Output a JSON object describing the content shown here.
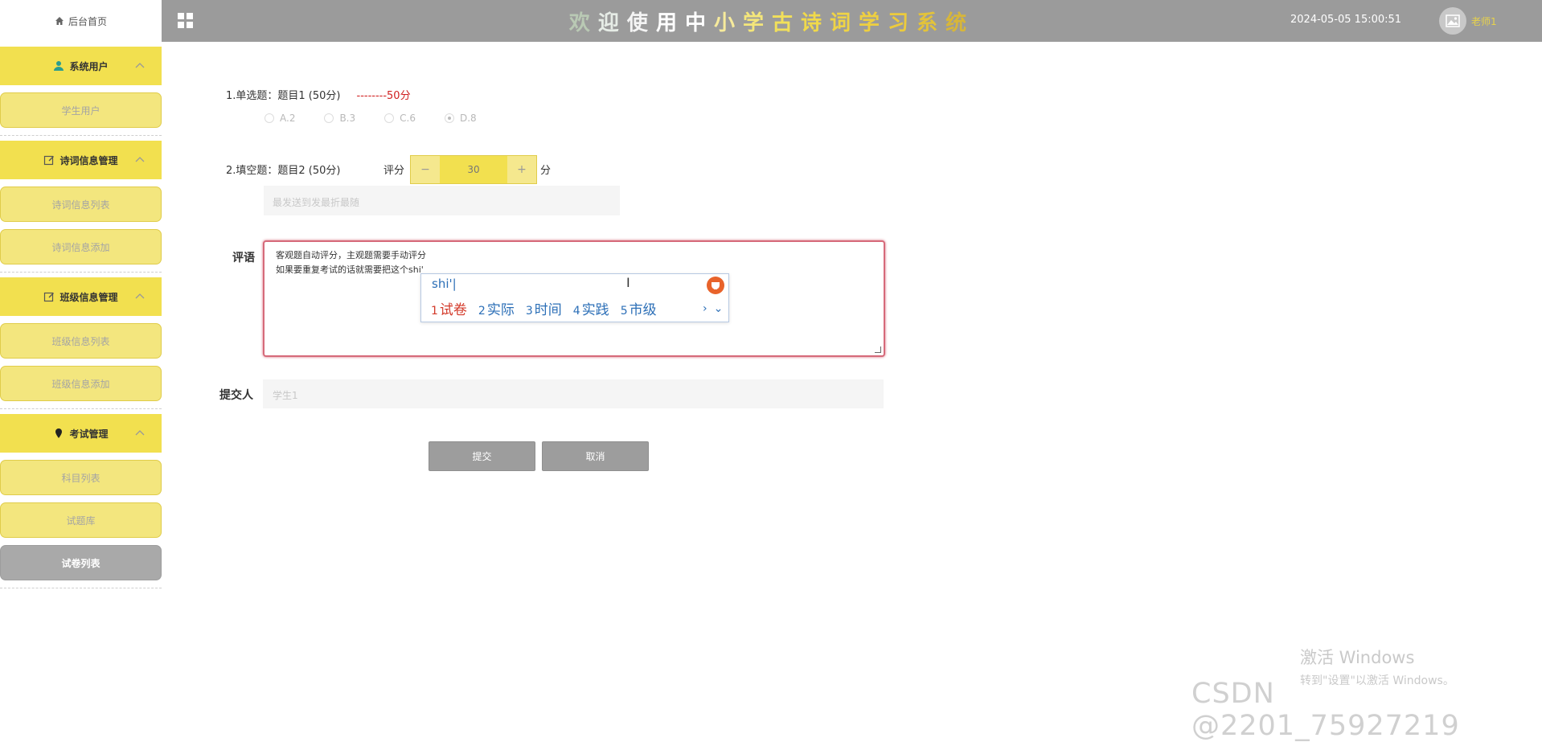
{
  "header": {
    "home_label": "后台首页",
    "title_chars": [
      {
        "ch": "欢",
        "color": "#b9c9b4"
      },
      {
        "ch": "迎",
        "color": "#e6ece6"
      },
      {
        "ch": "使",
        "color": "#f4f4f4"
      },
      {
        "ch": "用",
        "color": "#ffffff"
      },
      {
        "ch": "中",
        "color": "#ffffff"
      },
      {
        "ch": "小",
        "color": "#f7eb9c"
      },
      {
        "ch": "学",
        "color": "#f4e67a"
      },
      {
        "ch": "古",
        "color": "#f2e05a"
      },
      {
        "ch": "诗",
        "color": "#f0d94a"
      },
      {
        "ch": "词",
        "color": "#efd445"
      },
      {
        "ch": "学",
        "color": "#eecf40"
      },
      {
        "ch": "习",
        "color": "#eccb3c"
      },
      {
        "ch": "系",
        "color": "#e3c33a"
      },
      {
        "ch": "统",
        "color": "#d7b63a"
      }
    ],
    "datetime": "2024-05-05 15:00:51",
    "user_name": "老师1"
  },
  "sidebar": {
    "groups": [
      {
        "label": "系统用户",
        "icon": "user-icon",
        "items": [
          {
            "label": "学生用户"
          }
        ]
      },
      {
        "label": "诗词信息管理",
        "icon": "edit-icon",
        "items": [
          {
            "label": "诗词信息列表"
          },
          {
            "label": "诗词信息添加"
          }
        ]
      },
      {
        "label": "班级信息管理",
        "icon": "edit-icon",
        "items": [
          {
            "label": "班级信息列表"
          },
          {
            "label": "班级信息添加"
          }
        ]
      },
      {
        "label": "考试管理",
        "icon": "pin-icon",
        "items": [
          {
            "label": "科目列表"
          },
          {
            "label": "试题库"
          },
          {
            "label": "试卷列表",
            "active": true
          }
        ]
      }
    ]
  },
  "form": {
    "q1": {
      "title": "1.单选题：题目1 (50分)",
      "score_text": "--------50分",
      "options": [
        {
          "label": "A.2",
          "checked": false
        },
        {
          "label": "B.3",
          "checked": false
        },
        {
          "label": "C.6",
          "checked": false
        },
        {
          "label": "D.8",
          "checked": true
        }
      ]
    },
    "q2": {
      "title": "2.填空题：题目2 (50分)",
      "score_label": "评分",
      "score_value": "30",
      "minus": "−",
      "plus": "+",
      "unit": "分",
      "answer": "最发送到发最折最随"
    },
    "comment": {
      "label": "评语",
      "line1": "客观题自动评分，主观题需要手动评分",
      "line2": "如果要重复考试的话就需要把这个shi'"
    },
    "ime": {
      "input": "shi'|",
      "candidates": [
        {
          "num": "1",
          "text": "试卷"
        },
        {
          "num": "2",
          "text": "实际"
        },
        {
          "num": "3",
          "text": "时间"
        },
        {
          "num": "4",
          "text": "实践"
        },
        {
          "num": "5",
          "text": "市级"
        }
      ],
      "next": "›",
      "expand": "⌄"
    },
    "submitter": {
      "label": "提交人",
      "value": "学生1"
    },
    "buttons": {
      "submit": "提交",
      "cancel": "取消"
    }
  },
  "watermarks": {
    "windows_line1": "激活 Windows",
    "windows_line2": "转到\"设置\"以激活 Windows。",
    "csdn": "CSDN @2201_75927219"
  }
}
